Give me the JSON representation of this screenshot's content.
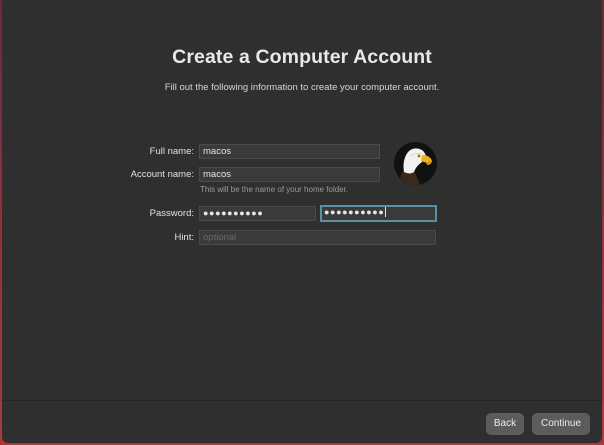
{
  "header": {
    "title": "Create a Computer Account",
    "subtitle": "Fill out the following information to create your computer account."
  },
  "form": {
    "full_name_label": "Full name:",
    "full_name_value": "macos",
    "account_name_label": "Account name:",
    "account_name_value": "macos",
    "account_name_help": "This will be the name of your home folder.",
    "password_label": "Password:",
    "password_value": "●●●●●●●●●●",
    "verify_value": "●●●●●●●●●●",
    "hint_label": "Hint:",
    "hint_placeholder": "optional"
  },
  "avatar": {
    "icon": "eagle-avatar-icon"
  },
  "footer": {
    "back_label": "Back",
    "continue_label": "Continue"
  },
  "colors": {
    "window_bg": "#2f2f2f",
    "focus_ring": "#5a8fa8",
    "button_bg": "#5c5c5c"
  }
}
